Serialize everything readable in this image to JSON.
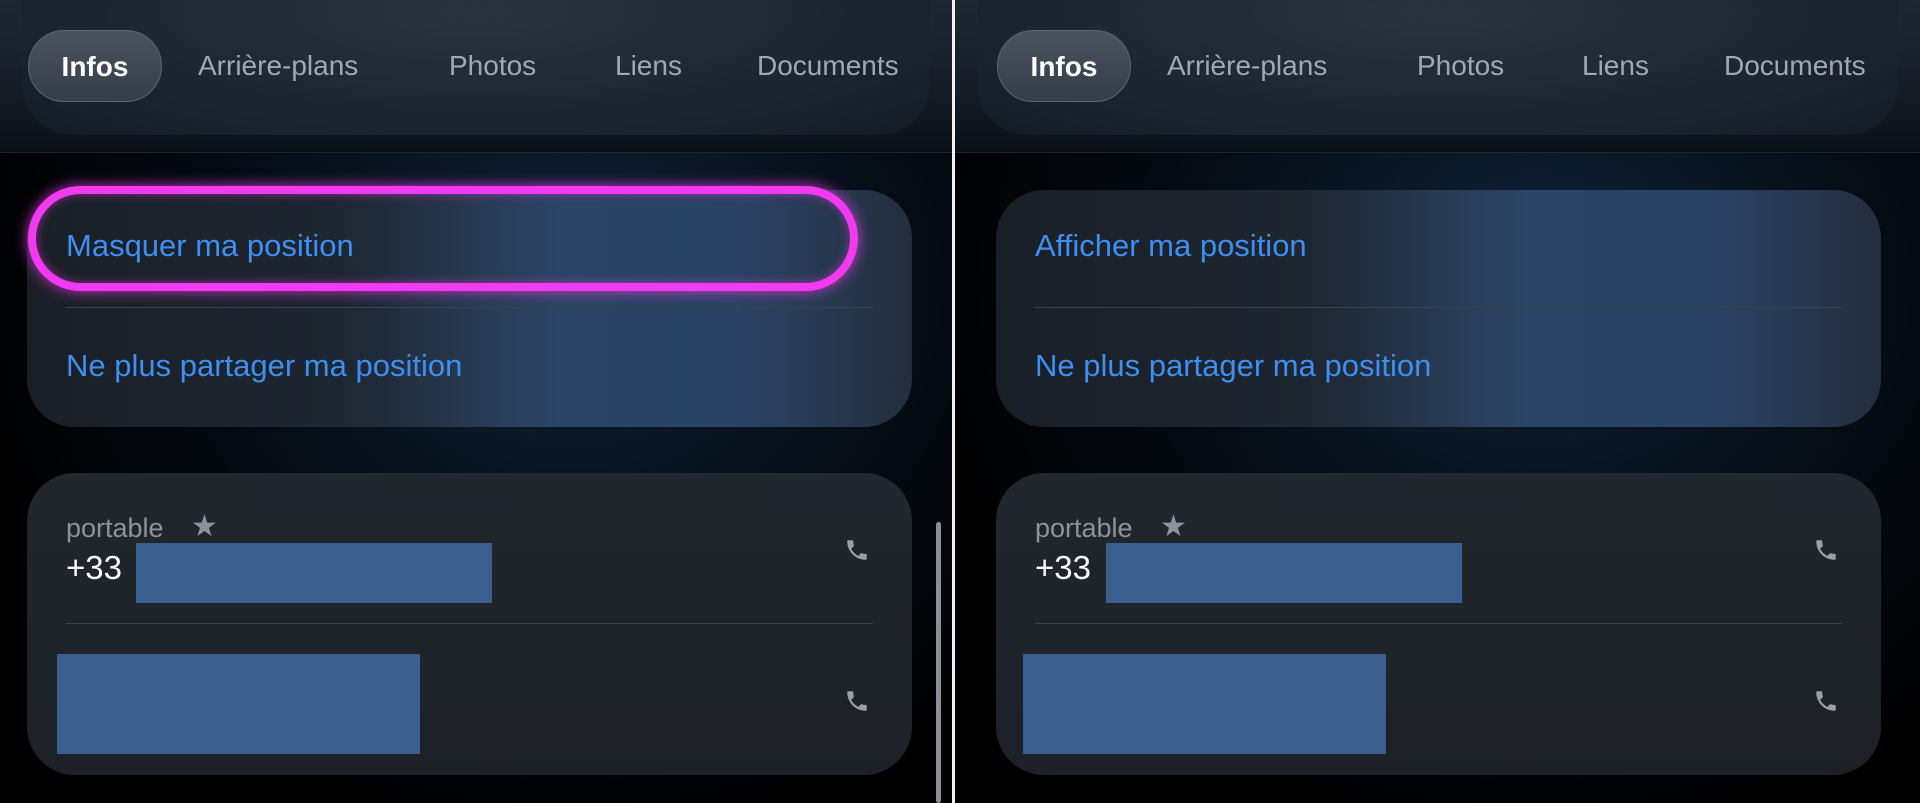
{
  "panels": [
    {
      "tabs": [
        "Infos",
        "Arrière-plans",
        "Photos",
        "Liens",
        "Documents"
      ],
      "location_actions": [
        "Masquer ma position",
        "Ne plus partager ma position"
      ],
      "phone_label": "portable",
      "phone_prefix": "+33"
    },
    {
      "tabs": [
        "Infos",
        "Arrière-plans",
        "Photos",
        "Liens",
        "Documents"
      ],
      "location_actions": [
        "Afficher ma position",
        "Ne plus partager ma position"
      ],
      "phone_label": "portable",
      "phone_prefix": "+33"
    }
  ],
  "icons": {
    "star": "star-icon",
    "phone": "phone-icon"
  },
  "colors": {
    "link": "#3d8ff2",
    "highlight": "#f23bf0",
    "redaction": "#3a5f8f"
  }
}
